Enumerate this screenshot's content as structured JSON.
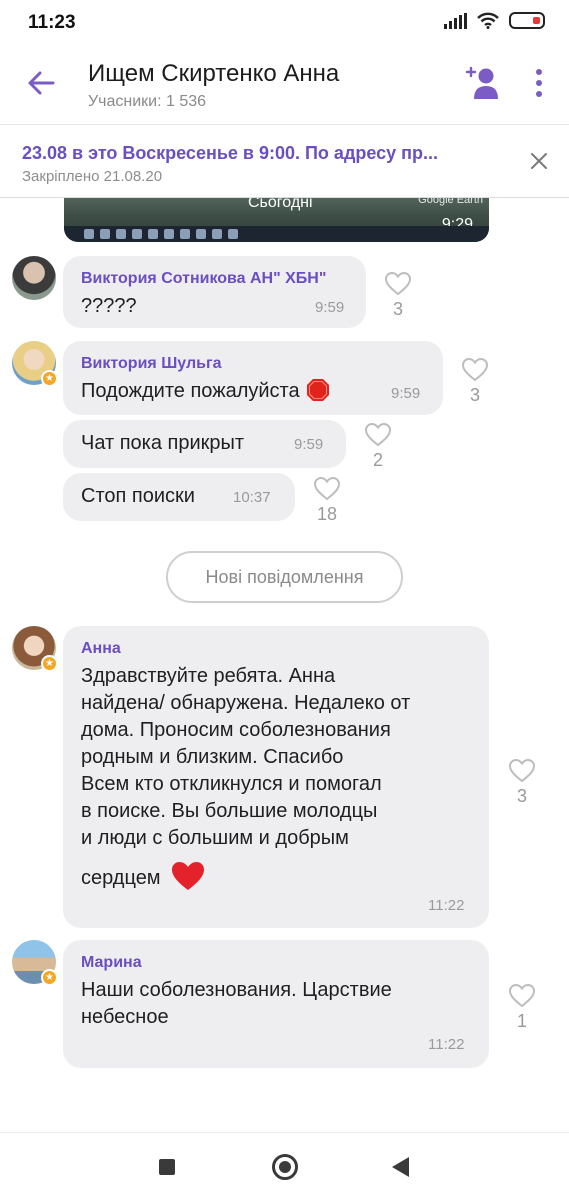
{
  "status_bar": {
    "time": "11:23"
  },
  "header": {
    "title": "Ищем Скиртенко Анна",
    "subtitle": "Учасники: 1 536"
  },
  "pinned": {
    "text": "23.08 в это Воскресенье в 9:00. По адресу пр...",
    "date": "Закріплено 21.08.20"
  },
  "image_message": {
    "overlay_text": "Сьогодні",
    "watermark": "Google Earth",
    "time": "9:29"
  },
  "messages": [
    {
      "sender": "Виктория Сотникова АН\" ХБН\"",
      "text": "?????",
      "time": "9:59",
      "likes": "3"
    },
    {
      "sender": "Виктория Шульга",
      "text": "Подождите пожалуйста",
      "emoji": "stop-sign",
      "time": "9:59",
      "likes": "3"
    },
    {
      "sender": "",
      "text": "Чат пока прикрыт",
      "time": "9:59",
      "likes": "2"
    },
    {
      "sender": "",
      "text": "Стоп поиски",
      "time": "10:37",
      "likes": "18"
    },
    {
      "sender": "Анна",
      "lines": [
        "Здравствуйте ребята. Анна",
        "найдена/ обнаружена. Недалеко от",
        "дома. Проносим соболезнования",
        "родным и близким. Спасибо",
        "Всем кто откликнулся и помогал",
        "в поиске.  Вы большие молодцы",
        "и люди с большим и добрым",
        "сердцем"
      ],
      "emoji": "red-heart",
      "time": "11:22",
      "likes": "3"
    },
    {
      "sender": "Марина",
      "lines": [
        "Наши соболезнования. Царствие",
        "небесное"
      ],
      "time": "11:22",
      "likes": "1"
    }
  ],
  "new_messages_label": "Нові повідомлення",
  "colors": {
    "accent": "#6b4fc0",
    "bubble": "#eeedf0",
    "icon_purple": "#7b5cc4"
  }
}
